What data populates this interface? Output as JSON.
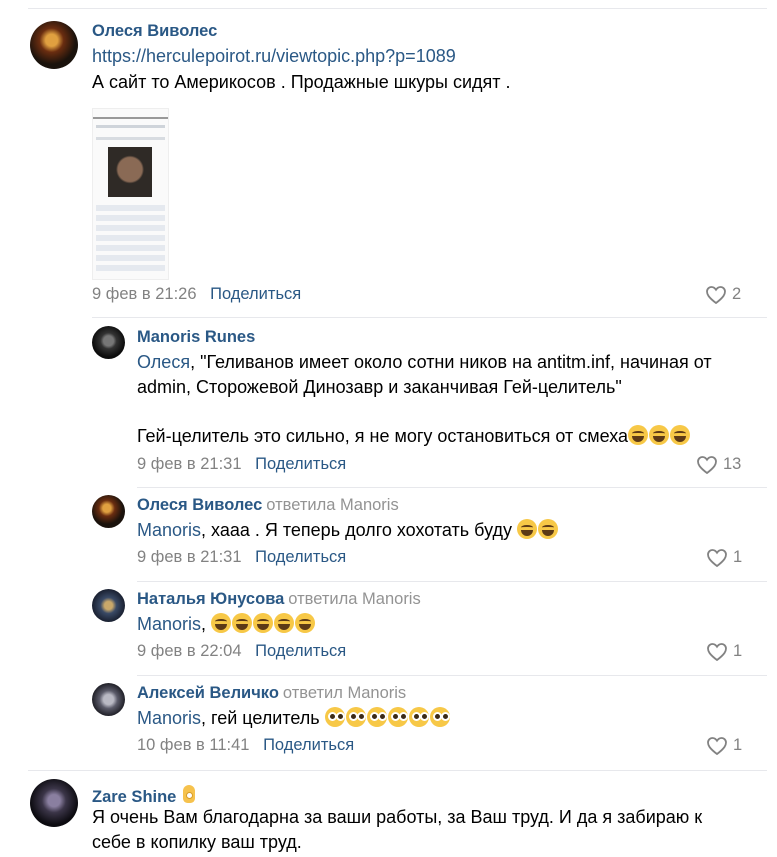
{
  "comments": [
    {
      "author": "Олеся Виволес",
      "reply_to": "",
      "link": "https://herculepoirot.ru/viewtopic.php?p=1089",
      "text": "А сайт то Америкосов . Продажные шкуры сидят .",
      "date": "9 фев в 21:26",
      "share": "Поделиться",
      "likes": "2"
    },
    {
      "author": "Manoris Runes",
      "reply_to": "",
      "mention": "Олеся",
      "text_line1": ", \"Геливанов имеет около сотни ников на antitm.inf, начиная от",
      "text_line2": "admin, Сторожевой Динозавр и заканчивая Гей-целитель\"",
      "text_line3": "Гей-целитель это сильно, я не могу остановиться от смеха",
      "date": "9 фев в 21:31",
      "share": "Поделиться",
      "likes": "13"
    },
    {
      "author": "Олеся Виволес",
      "reply_to": "ответила Manoris",
      "mention": "Manoris",
      "text": ", хааа . Я теперь долго хохотать буду",
      "date": "9 фев в 21:31",
      "share": "Поделиться",
      "likes": "1"
    },
    {
      "author": "Наталья Юнусова",
      "reply_to": "ответила Manoris",
      "mention": "Manoris",
      "text": ",",
      "date": "9 фев в 22:04",
      "share": "Поделиться",
      "likes": "1"
    },
    {
      "author": "Алексей Величко",
      "reply_to": "ответил Manoris",
      "mention": "Manoris",
      "text": ", гей целитель",
      "date": "10 фев в 11:41",
      "share": "Поделиться",
      "likes": "1"
    },
    {
      "author": "Zare Shine",
      "reply_to": "",
      "text_line1": "Я очень Вам благодарна за ваши работы, за Ваш труд. И да я забираю к",
      "text_line2": "себе в копилку ваш труд."
    }
  ],
  "icons": {
    "like": "heart-outline-icon",
    "laugh": "rolling-on-floor-laughing-emoji",
    "flushed": "flushed-face-emoji",
    "ok": "ok-hand-emoji"
  },
  "colors": {
    "link": "#2a5885",
    "muted": "#828282",
    "divider": "#e7e8ec"
  }
}
